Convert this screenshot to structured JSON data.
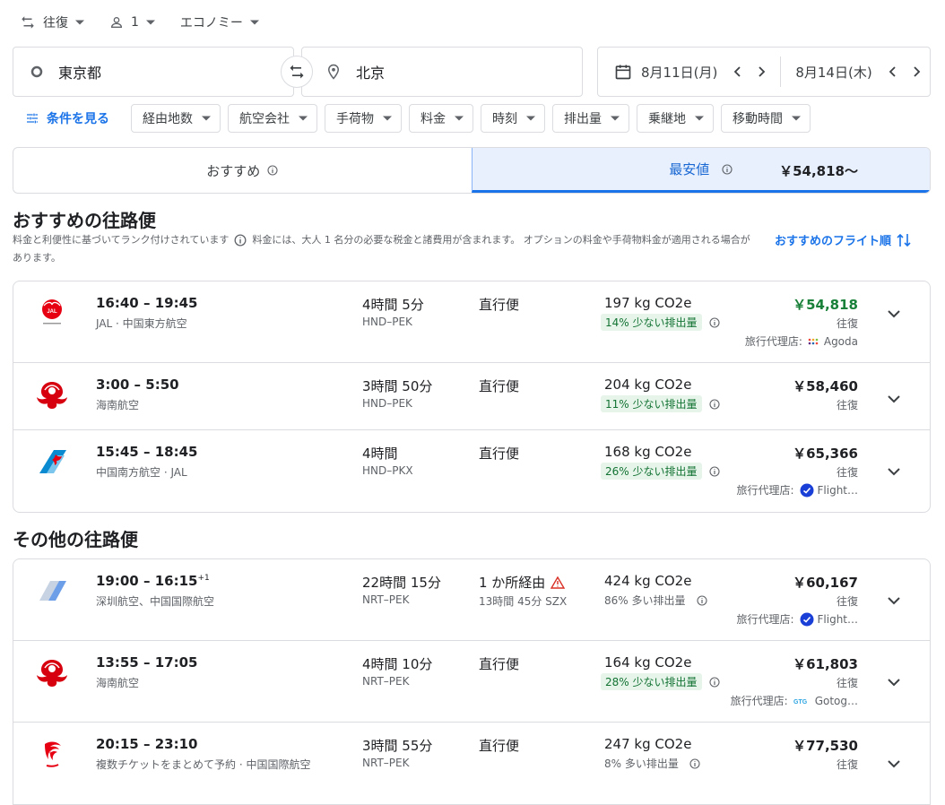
{
  "trip": {
    "type": "往復",
    "passengers": "1",
    "cabin": "エコノミー"
  },
  "search": {
    "origin": "東京都",
    "destination": "北京",
    "depart_date": "8月11日(月)",
    "return_date": "8月14日(木)"
  },
  "filters": {
    "see_all": "条件を見る",
    "chips": [
      "経由地数",
      "航空会社",
      "手荷物",
      "料金",
      "時刻",
      "排出量",
      "乗継地",
      "移動時間"
    ]
  },
  "tabs": {
    "best": "おすすめ",
    "cheapest": "最安値",
    "cheapest_price": "￥54,818～"
  },
  "best_section": {
    "title": "おすすめの往路便",
    "desc_rank": "料金と利便性に基づいてランク付けされています",
    "desc_fees": "料金には、大人 1 名分の必要な税金と諸費用が含まれます。 オプションの料金や手荷物料金が適用される場合があります。",
    "sort_label": "おすすめのフライト順"
  },
  "other_section": {
    "title": "その他の往路便"
  },
  "best_flights": [
    {
      "times": "16:40 – 19:45",
      "airline": "JAL · 中国東方航空",
      "duration": "4時間 5分",
      "route": "HND–PEK",
      "stops": "直行便",
      "co2": "197 kg CO2e",
      "emissions": "14% 少ない排出量",
      "price": "￥54,818",
      "price_type": "往復",
      "agency_label": "旅行代理店:",
      "agency": "Agoda",
      "logo": "jal-logo",
      "agency_icon": "agoda-icon"
    },
    {
      "times": "3:00 – 5:50",
      "airline": "海南航空",
      "duration": "3時間 50分",
      "route": "HND–PEK",
      "stops": "直行便",
      "co2": "204 kg CO2e",
      "emissions": "11% 少ない排出量",
      "price": "￥58,460",
      "price_type": "往復",
      "logo": "hainan-logo"
    },
    {
      "times": "15:45 – 18:45",
      "airline": "中国南方航空 · JAL",
      "duration": "4時間",
      "route": "HND–PKX",
      "stops": "直行便",
      "co2": "168 kg CO2e",
      "emissions": "26% 少ない排出量",
      "price": "￥65,366",
      "price_type": "往復",
      "agency_label": "旅行代理店:",
      "agency": "Flight…",
      "logo": "china-southern-logo",
      "agency_icon": "flightnetwork-icon"
    }
  ],
  "other_flights": [
    {
      "times": "19:00 – 16:15",
      "times_sup": "+1",
      "airline": "深圳航空、中国国際航空",
      "duration": "22時間 15分",
      "route": "NRT–PEK",
      "stops": "1 か所経由",
      "stop_detail": "13時間 45分 SZX",
      "co2": "424 kg CO2e",
      "emissions": "86% 多い排出量",
      "price": "￥60,167",
      "price_type": "往復",
      "agency_label": "旅行代理店:",
      "agency": "Flight…",
      "logo": "multi-airline-logo",
      "agency_icon": "flightnetwork-icon"
    },
    {
      "times": "13:55 – 17:05",
      "airline": "海南航空",
      "duration": "4時間 10分",
      "route": "NRT–PEK",
      "stops": "直行便",
      "co2": "164 kg CO2e",
      "emissions": "28% 少ない排出量",
      "price": "￥61,803",
      "price_type": "往復",
      "agency_label": "旅行代理店:",
      "agency": "Gotog…",
      "logo": "hainan-logo",
      "agency_icon": "gotogate-icon"
    },
    {
      "times": "20:15 – 23:10",
      "airline": "複数チケットをまとめて予約 · 中国国際航空",
      "duration": "3時間 55分",
      "route": "NRT–PEK",
      "stops": "直行便",
      "co2": "247 kg CO2e",
      "emissions": "8% 多い排出量",
      "price": "￥77,530",
      "price_type": "往復",
      "logo": "air-china-logo"
    }
  ]
}
